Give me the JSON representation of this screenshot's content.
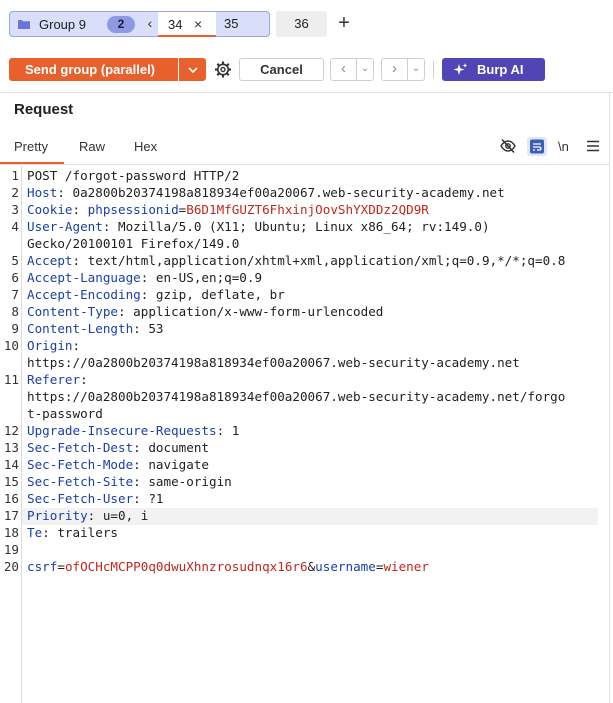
{
  "tabs": {
    "group_name": "Group 9",
    "group_count": "2",
    "group_collapse": "‹",
    "active_tab": "34",
    "close_glyph": "×",
    "tab_35": "35",
    "tab_36": "36",
    "add_glyph": "+"
  },
  "toolbar": {
    "send_label": "Send group (parallel)",
    "cancel_label": "Cancel",
    "burp_ai_label": "Burp AI",
    "accent": "#e8612d",
    "ai_color": "#5144b5"
  },
  "panel": {
    "title": "Request",
    "subtabs": [
      "Pretty",
      "Raw",
      "Hex"
    ],
    "newline_toggle": "\\n"
  },
  "request": {
    "line1": "POST /forgot-password HTTP/2",
    "headers": [
      {
        "name": "Host",
        "value": "0a2800b20374198a818934ef00a20067.web-security-academy.net"
      },
      {
        "name": "Cookie",
        "cookie_name": "phpsessionid",
        "cookie_value": "B6D1MfGUZT6FhxinjOovShYXDDz2QD9R"
      },
      {
        "name": "User-Agent",
        "value": "Mozilla/5.0 (X11; Ubuntu; Linux x86_64; rv:149.0)",
        "value_cont": "Gecko/20100101 Firefox/149.0"
      },
      {
        "name": "Accept",
        "value": "text/html,application/xhtml+xml,application/xml;q=0.9,*/*;q=0.8"
      },
      {
        "name": "Accept-Language",
        "value": "en-US,en;q=0.9"
      },
      {
        "name": "Accept-Encoding",
        "value": "gzip, deflate, br"
      },
      {
        "name": "Content-Type",
        "value": "application/x-www-form-urlencoded"
      },
      {
        "name": "Content-Length",
        "value": "53"
      },
      {
        "name": "Origin",
        "value_cont": "https://0a2800b20374198a818934ef00a20067.web-security-academy.net"
      },
      {
        "name": "Referer",
        "value_cont": "https://0a2800b20374198a818934ef00a20067.web-security-academy.net/forgo",
        "value_cont2": "t-password"
      },
      {
        "name": "Upgrade-Insecure-Requests",
        "value": "1"
      },
      {
        "name": "Sec-Fetch-Dest",
        "value": "document"
      },
      {
        "name": "Sec-Fetch-Mode",
        "value": "navigate"
      },
      {
        "name": "Sec-Fetch-Site",
        "value": "same-origin"
      },
      {
        "name": "Sec-Fetch-User",
        "value": "?1"
      },
      {
        "name": "Priority",
        "value": "u=0, i"
      },
      {
        "name": "Te",
        "value": "trailers"
      }
    ],
    "body": {
      "p1_name": "csrf",
      "p1_value": "ofOCHcMCPP0q0dwuXhnzrosudnqx16r6",
      "p2_name": "username",
      "p2_value": "wiener"
    },
    "line_numbers": [
      "1",
      "2",
      "3",
      "4",
      "5",
      "6",
      "7",
      "8",
      "9",
      "10",
      "11",
      "12",
      "13",
      "14",
      "15",
      "16",
      "17",
      "18",
      "19",
      "20"
    ]
  }
}
